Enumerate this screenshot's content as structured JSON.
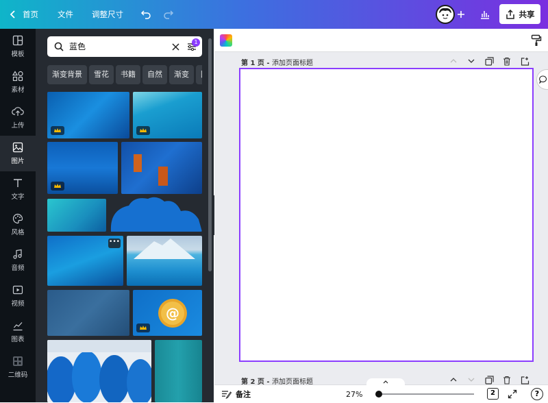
{
  "topbar": {
    "home_label": "首页",
    "file_label": "文件",
    "resize_label": "调整尺寸",
    "share_label": "共享",
    "colors": {
      "start": "#0fb5c9",
      "end": "#7a2fe0"
    }
  },
  "leftnav": {
    "items": [
      {
        "label": "模板",
        "icon": "template-icon"
      },
      {
        "label": "素材",
        "icon": "elements-icon"
      },
      {
        "label": "上传",
        "icon": "upload-icon"
      },
      {
        "label": "图片",
        "icon": "photo-icon",
        "active": true
      },
      {
        "label": "文字",
        "icon": "text-icon"
      },
      {
        "label": "风格",
        "icon": "palette-icon"
      },
      {
        "label": "音频",
        "icon": "music-icon"
      },
      {
        "label": "视频",
        "icon": "video-icon"
      },
      {
        "label": "图表",
        "icon": "chart-icon"
      },
      {
        "label": "二维码",
        "icon": "qrcode-icon"
      }
    ]
  },
  "panel": {
    "search_value": "蓝色",
    "filter_badge": "1",
    "chips": [
      "渐变背景",
      "雪花",
      "书籍",
      "自然",
      "渐变",
      "图"
    ]
  },
  "canvas": {
    "page1_prefix": "第 1 页 - ",
    "page1_title_placeholder": "添加页面标题",
    "page2_prefix": "第 2 页 - ",
    "page2_title_placeholder": "添加页面标题",
    "accent": "#8b3dff"
  },
  "bottombar": {
    "notes_label": "备注",
    "zoom": "27%",
    "page_count": "2",
    "help": "?"
  }
}
